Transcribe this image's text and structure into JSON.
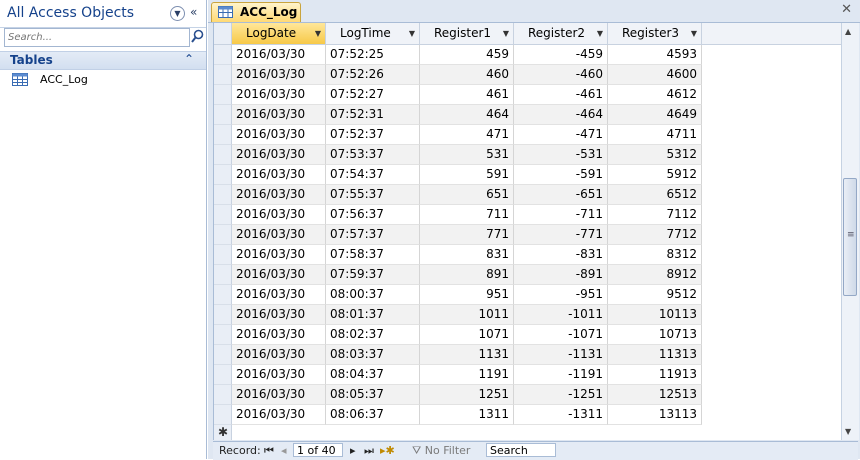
{
  "nav": {
    "title": "All Access Objects",
    "search_placeholder": "Search...",
    "group": "Tables",
    "items": [
      {
        "label": "ACC_Log",
        "icon": "table-icon"
      }
    ]
  },
  "tab": {
    "label": "ACC_Log",
    "icon": "table-icon"
  },
  "columns": [
    "LogDate",
    "LogTime",
    "Register1",
    "Register2",
    "Register3"
  ],
  "rows": [
    [
      "2016/03/30",
      "07:52:25",
      "459",
      "-459",
      "4593"
    ],
    [
      "2016/03/30",
      "07:52:26",
      "460",
      "-460",
      "4600"
    ],
    [
      "2016/03/30",
      "07:52:27",
      "461",
      "-461",
      "4612"
    ],
    [
      "2016/03/30",
      "07:52:31",
      "464",
      "-464",
      "4649"
    ],
    [
      "2016/03/30",
      "07:52:37",
      "471",
      "-471",
      "4711"
    ],
    [
      "2016/03/30",
      "07:53:37",
      "531",
      "-531",
      "5312"
    ],
    [
      "2016/03/30",
      "07:54:37",
      "591",
      "-591",
      "5912"
    ],
    [
      "2016/03/30",
      "07:55:37",
      "651",
      "-651",
      "6512"
    ],
    [
      "2016/03/30",
      "07:56:37",
      "711",
      "-711",
      "7112"
    ],
    [
      "2016/03/30",
      "07:57:37",
      "771",
      "-771",
      "7712"
    ],
    [
      "2016/03/30",
      "07:58:37",
      "831",
      "-831",
      "8312"
    ],
    [
      "2016/03/30",
      "07:59:37",
      "891",
      "-891",
      "8912"
    ],
    [
      "2016/03/30",
      "08:00:37",
      "951",
      "-951",
      "9512"
    ],
    [
      "2016/03/30",
      "08:01:37",
      "1011",
      "-1011",
      "10113"
    ],
    [
      "2016/03/30",
      "08:02:37",
      "1071",
      "-1071",
      "10713"
    ],
    [
      "2016/03/30",
      "08:03:37",
      "1131",
      "-1131",
      "11313"
    ],
    [
      "2016/03/30",
      "08:04:37",
      "1191",
      "-1191",
      "11913"
    ],
    [
      "2016/03/30",
      "08:05:37",
      "1251",
      "-1251",
      "12513"
    ],
    [
      "2016/03/30",
      "08:06:37",
      "1311",
      "-1311",
      "13113"
    ]
  ],
  "status": {
    "record_label": "Record:",
    "record_value": "1 of 40",
    "filter": "No Filter",
    "search": "Search"
  },
  "colors": {
    "active_header": "#f7c948",
    "tab": "#ffd974",
    "nav_text": "#15428b"
  }
}
